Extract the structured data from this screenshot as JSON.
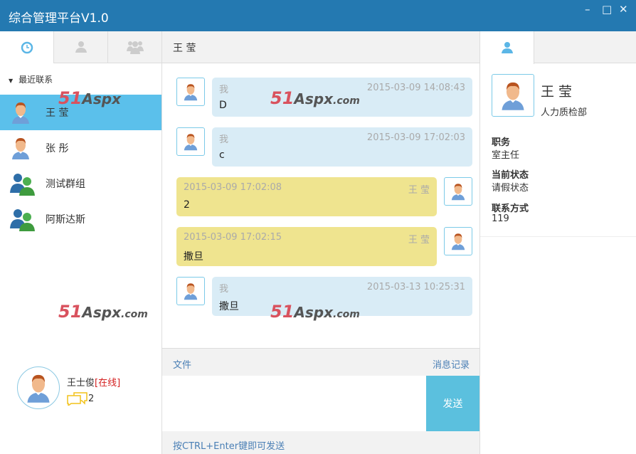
{
  "window": {
    "title": "综合管理平台V1.0",
    "minimize": "–",
    "maximize": "□",
    "close": "✕"
  },
  "left": {
    "group_label": "最近联系",
    "contacts": [
      {
        "name": "王 莹",
        "type": "person"
      },
      {
        "name": "张 彤",
        "type": "person"
      },
      {
        "name": "测试群组",
        "type": "group"
      },
      {
        "name": "阿斯达斯",
        "type": "group"
      }
    ],
    "me": {
      "name": "王士俊",
      "status": "[在线]",
      "message_count": "2"
    }
  },
  "chat": {
    "title": "王 莹",
    "messages": [
      {
        "side": "left",
        "sender": "我",
        "time": "2015-03-09 14:08:43",
        "text": "D"
      },
      {
        "side": "left",
        "sender": "我",
        "time": "2015-03-09 17:02:03",
        "text": "c"
      },
      {
        "side": "right",
        "sender": "王 莹",
        "time": "2015-03-09 17:02:08",
        "text": "2"
      },
      {
        "side": "right",
        "sender": "王 莹",
        "time": "2015-03-09 17:02:15",
        "text": "撒旦"
      },
      {
        "side": "left",
        "sender": "我",
        "time": "2015-03-13 10:25:31",
        "text": "撒旦"
      }
    ],
    "file_label": "文件",
    "history_label": "消息记录",
    "send_label": "发送",
    "hint": "按CTRL+Enter键即可发送"
  },
  "profile": {
    "name": "王 莹",
    "dept": "人力质检部",
    "fields": [
      {
        "label": "职务",
        "value": "室主任"
      },
      {
        "label": "当前状态",
        "value": "请假状态"
      },
      {
        "label": "联系方式",
        "value": "119"
      }
    ]
  },
  "watermark": {
    "a": "51",
    "b": "Aspx",
    ".c": ".com"
  },
  "colors": {
    "titlebar": "#2479b1",
    "selected": "#5bc0eb",
    "bubble_me": "#d9ecf6",
    "bubble_other": "#efe48f",
    "send": "#5bc0de"
  }
}
